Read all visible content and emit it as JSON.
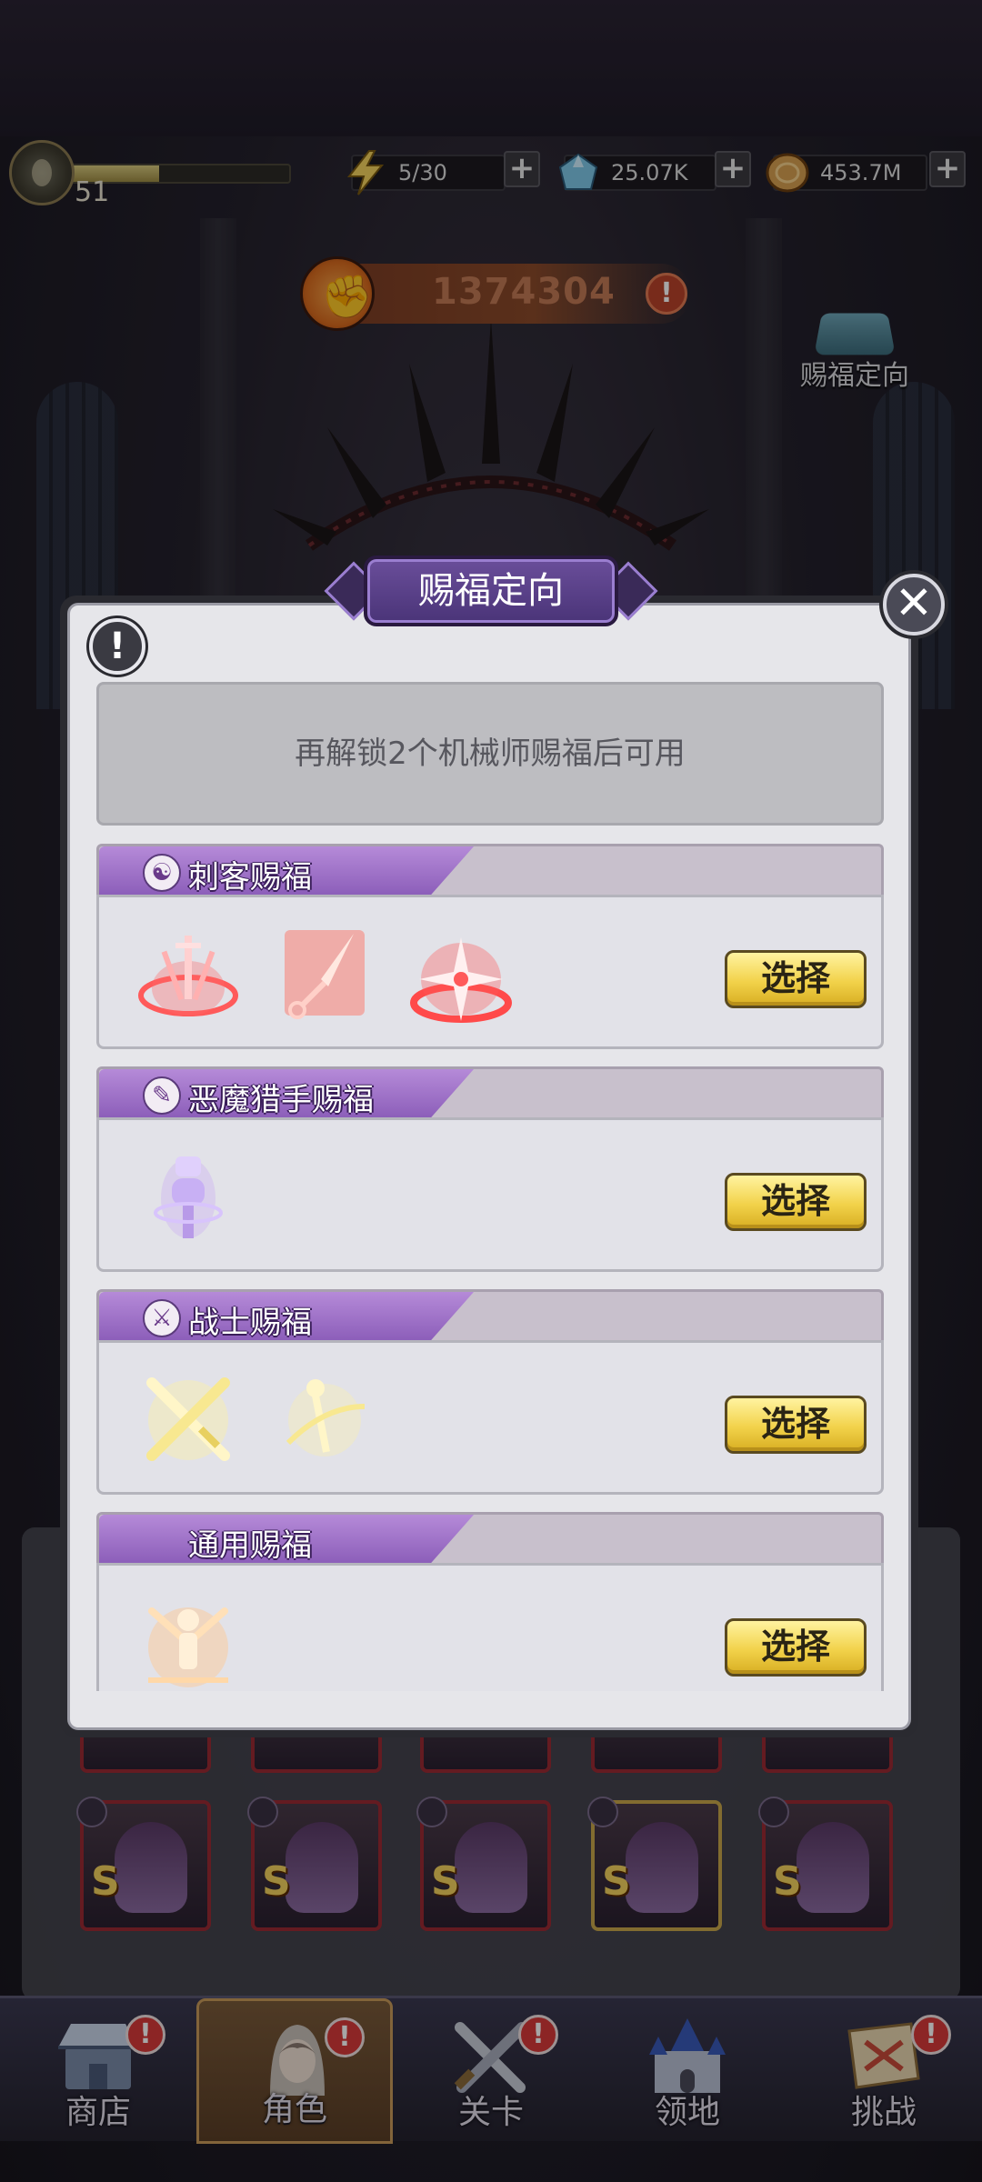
{
  "hud": {
    "level": "51",
    "xp_fraction": 0.42,
    "energy": "5/30",
    "gems": "25.07K",
    "coins": "453.7M",
    "plus": "+"
  },
  "power": {
    "value": "1374304",
    "info_glyph": "!"
  },
  "direction_button": {
    "label": "赐福定向"
  },
  "modal": {
    "title": "赐福定向",
    "close_glyph": "✕",
    "info_glyph": "!",
    "notice": "再解锁2个机械师赐福后可用",
    "blessings": [
      {
        "title": "刺客赐福",
        "icon": "assassin-icon",
        "select_label": "选择",
        "skills": [
          "sword-ring-icon",
          "kunai-icon",
          "shuriken-icon"
        ]
      },
      {
        "title": "恶魔猎手赐福",
        "icon": "demon-hunter-icon",
        "select_label": "选择",
        "skills": [
          "spirit-totem-icon"
        ]
      },
      {
        "title": "战士赐福",
        "icon": "warrior-icon",
        "select_label": "选择",
        "skills": [
          "crossed-swords-icon",
          "spinning-blade-icon"
        ]
      },
      {
        "title": "通用赐福",
        "icon": "general-icon",
        "select_label": "选择",
        "skills": [
          "burst-figure-icon"
        ]
      }
    ]
  },
  "nav": {
    "items": [
      {
        "label": "商店",
        "icon": "shop-icon",
        "badge": "!",
        "active": false
      },
      {
        "label": "角色",
        "icon": "character-icon",
        "badge": "!",
        "active": true
      },
      {
        "label": "关卡",
        "icon": "stage-icon",
        "badge": "!",
        "active": false
      },
      {
        "label": "领地",
        "icon": "territory-icon",
        "badge": "",
        "active": false
      },
      {
        "label": "挑战",
        "icon": "challenge-icon",
        "badge": "!",
        "active": false
      }
    ]
  },
  "hero_grid": {
    "rank_letter": "S"
  },
  "colors": {
    "accent_purple": "#8a5cb8",
    "select_gold": "#f2d24a",
    "badge_red": "#d83a3a",
    "power_orange": "#d86a1e"
  }
}
